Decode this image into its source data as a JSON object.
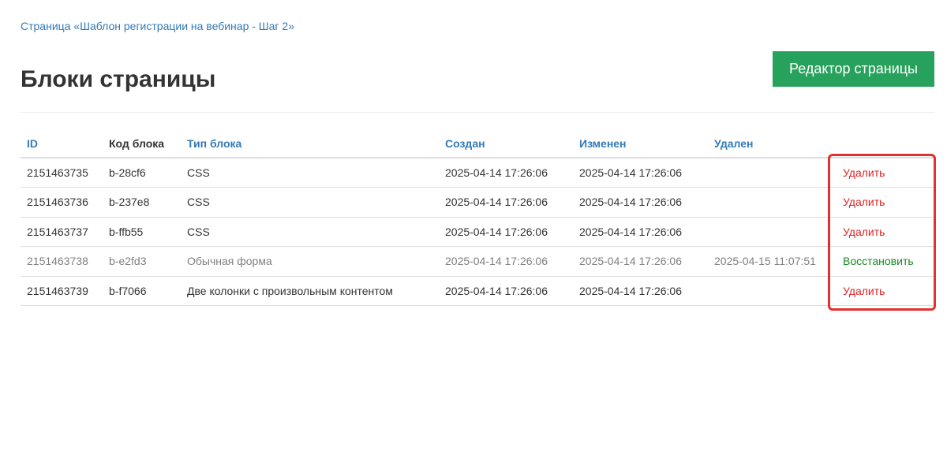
{
  "breadcrumb": "Страница «Шаблон регистрации на вебинар - Шаг 2»",
  "title": "Блоки страницы",
  "editor_button": "Редактор страницы",
  "columns": {
    "id": "ID",
    "code": "Код блока",
    "type": "Тип блока",
    "created": "Создан",
    "modified": "Изменен",
    "deleted": "Удален"
  },
  "rows": [
    {
      "id": "2151463735",
      "code": "b-28cf6",
      "type": "CSS",
      "created": "2025-04-14 17:26:06",
      "modified": "2025-04-14 17:26:06",
      "deleted": "",
      "action": "Удалить"
    },
    {
      "id": "2151463736",
      "code": "b-237e8",
      "type": "CSS",
      "created": "2025-04-14 17:26:06",
      "modified": "2025-04-14 17:26:06",
      "deleted": "",
      "action": "Удалить"
    },
    {
      "id": "2151463737",
      "code": "b-ffb55",
      "type": "CSS",
      "created": "2025-04-14 17:26:06",
      "modified": "2025-04-14 17:26:06",
      "deleted": "",
      "action": "Удалить"
    },
    {
      "id": "2151463738",
      "code": "b-e2fd3",
      "type": "Обычная форма",
      "created": "2025-04-14 17:26:06",
      "modified": "2025-04-14 17:26:06",
      "deleted": "2025-04-15 11:07:51",
      "action": "Восстановить"
    },
    {
      "id": "2151463739",
      "code": "b-f7066",
      "type": "Две колонки с произвольным контентом",
      "created": "2025-04-14 17:26:06",
      "modified": "2025-04-14 17:26:06",
      "deleted": "",
      "action": "Удалить"
    }
  ],
  "colors": {
    "link": "#337ab7",
    "button": "#27a25c",
    "delete": "#e02424",
    "restore": "#16891e",
    "highlight": "#e03030"
  }
}
